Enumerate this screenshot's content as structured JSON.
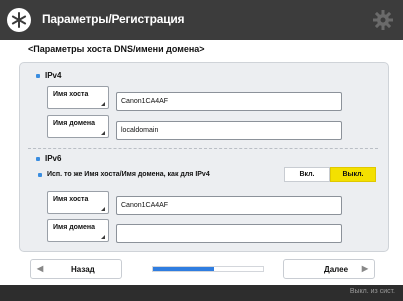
{
  "header": {
    "title": "Параметры/Регистрация",
    "menu_icon": "asterisk-circle-icon",
    "settings_icon": "gear-icon"
  },
  "subtitle": "<Параметры хоста DNS/имени домена>",
  "ipv4": {
    "label": "IPv4",
    "host_btn": "Имя хоста",
    "host_value": "Canon1CA4AF",
    "domain_btn": "Имя домена",
    "domain_value": "localdomain"
  },
  "ipv6": {
    "label": "IPv6",
    "note": "Исп. то же Имя хоста/Имя домена, как для IPv4",
    "toggle_off": "Вкл.",
    "toggle_on": "Выкл.",
    "host_btn": "Имя хоста",
    "host_value": "Canon1CA4AF",
    "domain_btn": "Имя домена",
    "domain_value": ""
  },
  "footer": {
    "back_label": "Назад",
    "next_label": "Далее",
    "progress": 0.55
  },
  "status": "Выкл. из сист.",
  "colors": {
    "header_bg": "#3c3c3c",
    "accent": "#2f7de0",
    "toggle_selected": "#f4e000"
  }
}
